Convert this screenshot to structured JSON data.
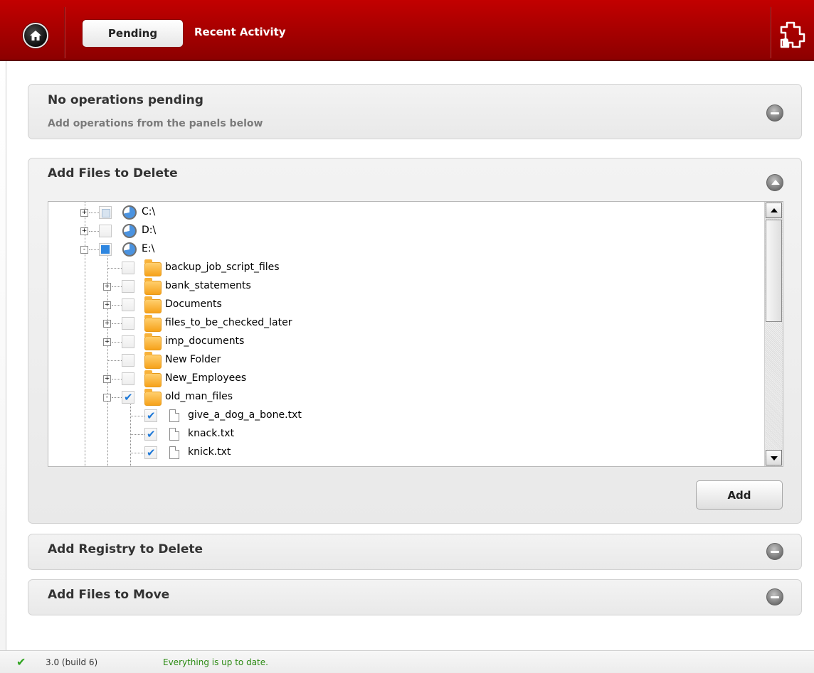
{
  "header": {
    "tabs": [
      {
        "label": "Pending",
        "active": true
      },
      {
        "label": "Recent Activity",
        "active": false
      }
    ],
    "brand_color": "#a50000"
  },
  "pending_panel": {
    "title": "No operations pending",
    "subtitle": "Add operations from the panels below",
    "expanded": false
  },
  "delete_files_panel": {
    "title": "Add Files to Delete",
    "expanded": true,
    "tree": [
      {
        "label": "C:\\",
        "type": "drive",
        "check": "partial",
        "expander": "+"
      },
      {
        "label": "D:\\",
        "type": "drive",
        "check": "none",
        "expander": "+"
      },
      {
        "label": "E:\\",
        "type": "drive",
        "check": "filled",
        "expander": "-"
      },
      {
        "label": "backup_job_script_files",
        "type": "folder",
        "check": "none",
        "expander": ""
      },
      {
        "label": "bank_statements",
        "type": "folder",
        "check": "none",
        "expander": "+"
      },
      {
        "label": "Documents",
        "type": "folder",
        "check": "none",
        "expander": "+"
      },
      {
        "label": "files_to_be_checked_later",
        "type": "folder",
        "check": "none",
        "expander": "+"
      },
      {
        "label": "imp_documents",
        "type": "folder",
        "check": "none",
        "expander": "+"
      },
      {
        "label": "New Folder",
        "type": "folder",
        "check": "none",
        "expander": ""
      },
      {
        "label": "New_Employees",
        "type": "folder",
        "check": "none",
        "expander": "+"
      },
      {
        "label": "old_man_files",
        "type": "folder",
        "check": "checked",
        "expander": "-"
      },
      {
        "label": "give_a_dog_a_bone.txt",
        "type": "file",
        "check": "checked",
        "expander": ""
      },
      {
        "label": "knack.txt",
        "type": "file",
        "check": "checked",
        "expander": ""
      },
      {
        "label": "knick.txt",
        "type": "file",
        "check": "checked",
        "expander": ""
      }
    ],
    "add_button": "Add"
  },
  "registry_panel": {
    "title": "Add Registry to Delete",
    "expanded": false
  },
  "move_panel": {
    "title": "Add Files to Move",
    "expanded": false
  },
  "status": {
    "version": "3.0 (build 6)",
    "message": "Everything is up to date.",
    "ok_color": "#2ea31e"
  }
}
